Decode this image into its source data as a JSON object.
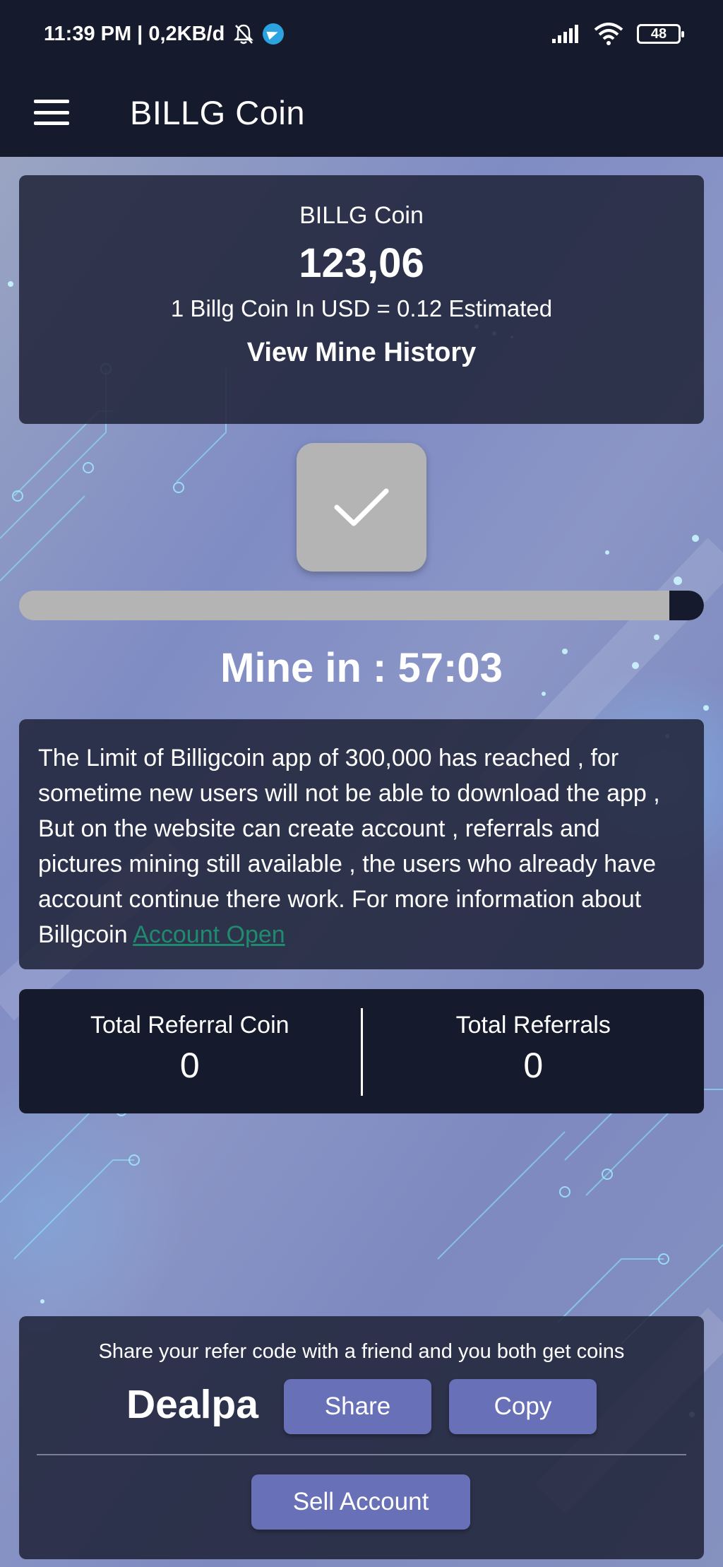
{
  "status_bar": {
    "time": "11:39 PM | 0,2KB/d",
    "battery": "48"
  },
  "app_bar": {
    "title": "BILLG Coin"
  },
  "balance": {
    "label": "BILLG Coin",
    "value": "123,06",
    "rate_text": "1 Billg Coin In USD = 0.12 Estimated",
    "history_link": "View Mine History"
  },
  "mining": {
    "progress_remaining": 0.05,
    "timer_text": "Mine in : 57:03"
  },
  "notice": {
    "text": "The Limit of Billigcoin app of 300,000 has reached , for sometime new users will not be able to download the app , But on the website can create account , referrals and pictures mining still available , the users who already have account continue there work. For more information about Billgcoin ",
    "link_text": "Account Open"
  },
  "referrals": {
    "coin_label": "Total Referral Coin",
    "coin_value": "0",
    "count_label": "Total Referrals",
    "count_value": "0"
  },
  "share": {
    "text": "Share your refer code with a friend and you both get coins",
    "code": "Dealpa",
    "share_label": "Share",
    "copy_label": "Copy",
    "sell_label": "Sell Account"
  },
  "icons": {
    "menu": "hamburger-menu-icon",
    "check": "checkmark-icon",
    "notifications_off": "bell-off-icon",
    "telegram": "telegram-icon",
    "signal": "signal-icon",
    "wifi": "wifi-icon",
    "battery": "battery-icon"
  },
  "colors": {
    "bar_bg": "#151a2c",
    "button_purple": "#6871b8",
    "link_green": "#1f8a6e",
    "check_button": "#b4b4b4"
  }
}
